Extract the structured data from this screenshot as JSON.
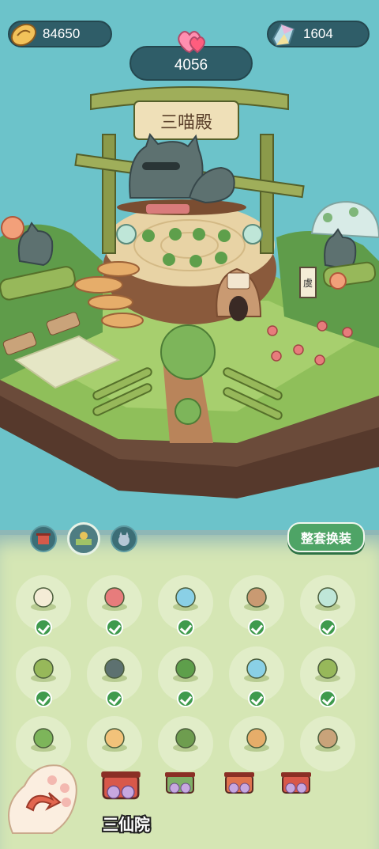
{
  "resources": {
    "coins": "84650",
    "hearts": "4056",
    "gems": "1604"
  },
  "scene": {
    "temple_sign": "三喵殿",
    "scroll_glyph": "虞"
  },
  "tabs": [
    {
      "icon": "shrine-tab-icon"
    },
    {
      "icon": "garden-tab-icon"
    },
    {
      "icon": "cat-tab-icon"
    }
  ],
  "panel": {
    "swap_all_label": "整套换装"
  },
  "items": [
    {
      "icon": "scroll-icon",
      "equipped": true
    },
    {
      "icon": "flower-plant-icon",
      "equipped": true
    },
    {
      "icon": "spirit-cat-plant-icon",
      "equipped": true
    },
    {
      "icon": "hut-icon",
      "equipped": true
    },
    {
      "icon": "lantern-icon",
      "equipped": true
    },
    {
      "icon": "bamboo-cat-icon",
      "equipped": true
    },
    {
      "icon": "sleeping-cat-statue-icon",
      "equipped": true
    },
    {
      "icon": "clover-icon",
      "equipped": true
    },
    {
      "icon": "blue-flower-plant-icon",
      "equipped": true
    },
    {
      "icon": "bamboo-fence-icon",
      "equipped": true
    },
    {
      "icon": "bush-icon",
      "equipped": false
    },
    {
      "icon": "stool-icon",
      "equipped": false
    },
    {
      "icon": "pine-icon",
      "equipped": false
    },
    {
      "icon": "mushroom-icon",
      "equipped": false
    },
    {
      "icon": "stump-icon",
      "equipped": false
    }
  ],
  "sets": [
    {
      "label": "三仙院",
      "selected": true
    },
    {
      "label": "",
      "selected": false
    },
    {
      "label": "",
      "selected": false
    },
    {
      "label": "",
      "selected": false
    }
  ],
  "colors": {
    "sky": "#6cc3ca",
    "panel": "#d5e6b4",
    "button_green": "#4ea466",
    "pill": "#2f5d68"
  }
}
